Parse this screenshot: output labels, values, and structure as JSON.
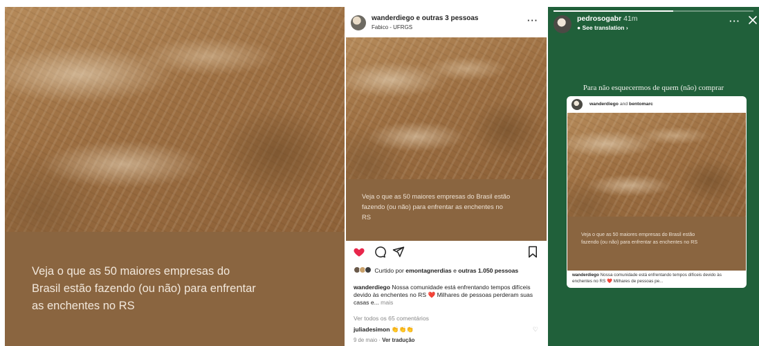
{
  "post_caption": "Veja o que as 50 maiores empresas do Brasil estão fazendo (ou não) para enfrentar as enchentes no RS",
  "post": {
    "username": "wanderdiego e outras 3 pessoas",
    "location": "Fabico - UFRGS",
    "more": "···",
    "likes_prefix": "Curtido por",
    "likes_user": "emontagnerdias",
    "likes_mid": "e",
    "likes_count": "outras 1.050 pessoas",
    "desc_user": "wanderdiego",
    "desc_text": "Nossa comunidade está enfrentando tempos difíceis devido às enchentes no RS ❤️ Milhares de pessoas perderam suas casas e...",
    "desc_more": "mais",
    "all_comments": "Ver todos os 65 comentários",
    "comment_user": "juliadesimon",
    "comment_text": "👏👏👏",
    "date": "9 de maio",
    "separator": "·",
    "translate": "Ver tradução"
  },
  "story": {
    "username": "pedrosogabr",
    "time": "41m",
    "translation": "See translation ›",
    "more": "···",
    "title": "Para não esquecermos de quem (não) comprar",
    "progress": 0.6,
    "card_user1": "wanderdiego",
    "card_and": "and",
    "card_user2": "bentomarc",
    "card_desc_user": "wanderdiego",
    "card_desc_text": "Nossa comunidade está enfrentando tempos difíceis devido às enchentes no RS ❤️ Milhares de pessoas pe..."
  },
  "colors": {
    "heart": "#e8264b",
    "story_bg": "#20603a",
    "caption_bg": "#8a6540"
  }
}
